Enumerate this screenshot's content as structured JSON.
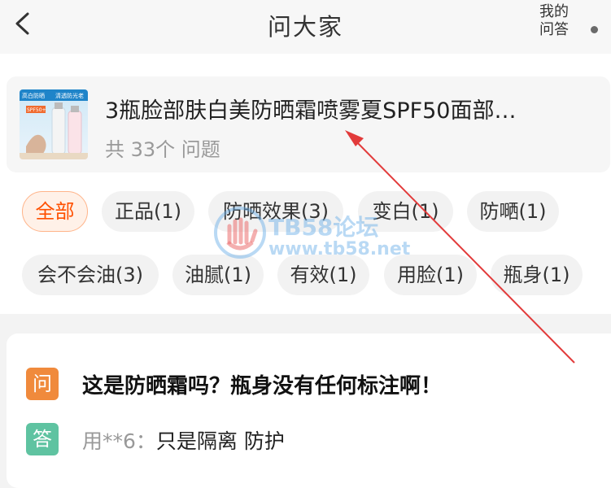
{
  "header": {
    "title": "问大家",
    "my_qa_line1": "我的",
    "my_qa_line2": "问答"
  },
  "product": {
    "title": "3瓶脸部肤白美防晒霜喷雾夏SPF50面部…",
    "count": "共 33个 问题",
    "thumb_texts": [
      "高白防晒",
      "清透防光老",
      "SPF50+"
    ]
  },
  "tags": [
    {
      "label": "全部",
      "active": true
    },
    {
      "label": "正品(1)"
    },
    {
      "label": "防晒效果(3)"
    },
    {
      "label": "变白(1)"
    },
    {
      "label": "防嗮(1)"
    },
    {
      "label": "会不会油(3)"
    },
    {
      "label": "油腻(1)"
    },
    {
      "label": "有效(1)"
    },
    {
      "label": "用脸(1)"
    },
    {
      "label": "瓶身(1)"
    }
  ],
  "watermark": {
    "line1": "TB58论坛",
    "line2": "www.tb58.net"
  },
  "qa": {
    "q_badge": "问",
    "question": "这是防晒霜吗？瓶身没有任何标注啊！",
    "a_badge": "答",
    "answer_user": "用**6：",
    "answer_text": "只是隔离 防护"
  },
  "colors": {
    "accent": "#ff5000",
    "question_badge": "#f08a3c",
    "answer_badge": "#5fc3a1",
    "annotation_arrow": "#e23b3b"
  }
}
